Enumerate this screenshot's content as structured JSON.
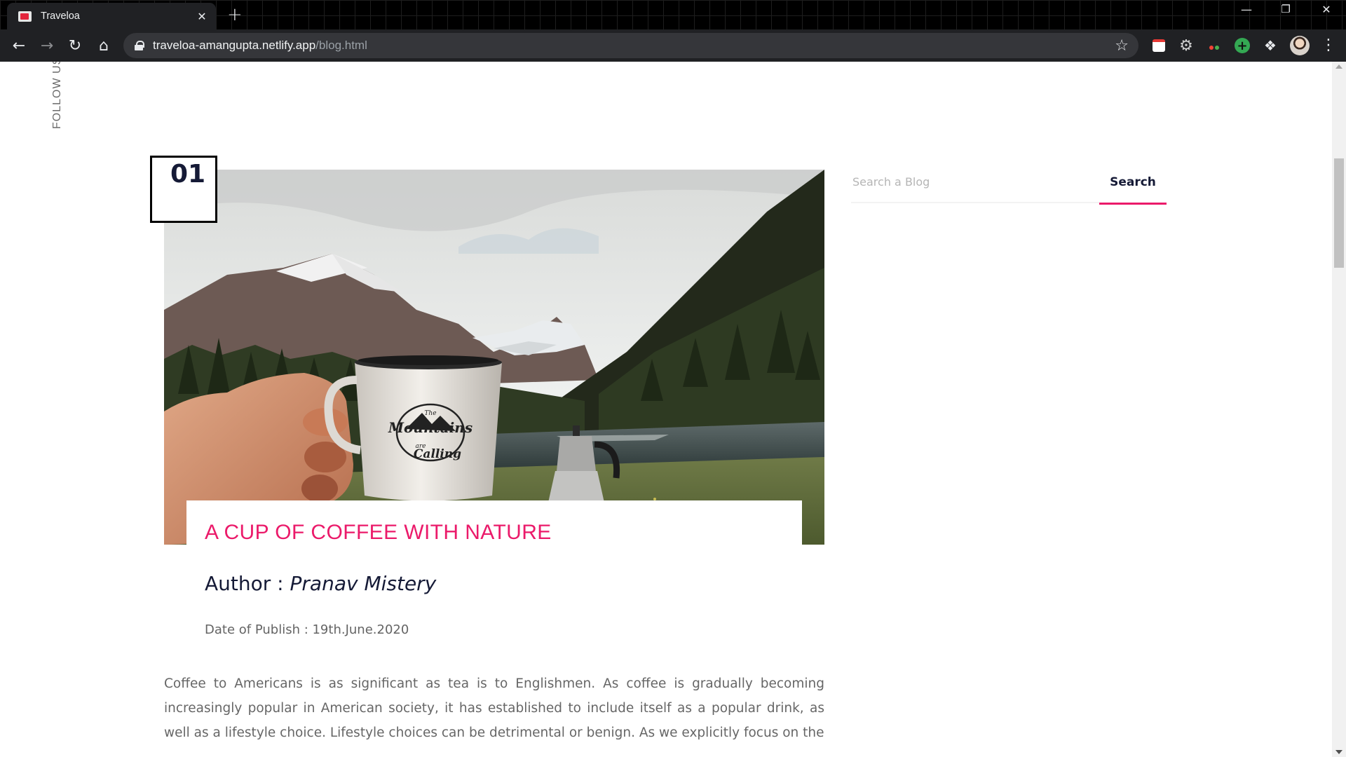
{
  "browser": {
    "tab_title": "Traveloa",
    "tab_close": "✕",
    "new_tab": "+",
    "url_host": "traveloa-amangupta.netlify.app",
    "url_path": "/blog.html",
    "window_controls": [
      "minimize",
      "restore",
      "close"
    ],
    "extensions": [
      "calendar-extension",
      "settings-extension",
      "color-picker-extension",
      "add-extension",
      "extensions-puzzle"
    ]
  },
  "sidebar": {
    "follow_us": "FOLLOW US"
  },
  "post": {
    "number": "01",
    "image_description_icon": "mountain-coffee-image",
    "title": "A CUP OF COFFEE WITH NATURE",
    "author_label": "Author : ",
    "author_name": "Pranav Mistery",
    "date_line": "Date of Publish : 19th.June.2020",
    "body": "Coffee to Americans is as significant as tea is to Englishmen. As coffee is gradually becoming increasingly popular in American society, it has established to include itself as a popular drink, as well as a lifestyle choice. Lifestyle choices can be detrimental or benign. As we explicitly focus on the",
    "mug_text": [
      "The",
      "Mountains",
      "are",
      "Calling"
    ]
  },
  "search": {
    "placeholder": "Search a Blog",
    "button_label": "Search"
  },
  "colors": {
    "accent": "#eb1a6a",
    "heading": "#151a36",
    "text": "#666666"
  }
}
